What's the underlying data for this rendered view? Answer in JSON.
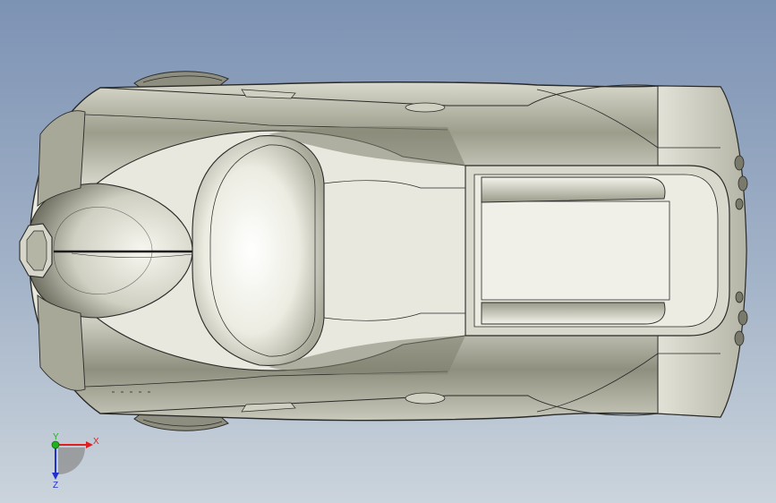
{
  "viewport": {
    "background_top": "#7d93b4",
    "background_bottom": "#c9d3dc",
    "model_color": "#c9c9bd",
    "edge_color": "#2a2a28"
  },
  "triad": {
    "x_label": "X",
    "y_label": "Y",
    "z_label": "Z",
    "x_color": "#e02020",
    "y_color": "#20b020",
    "z_color": "#2030d0"
  }
}
